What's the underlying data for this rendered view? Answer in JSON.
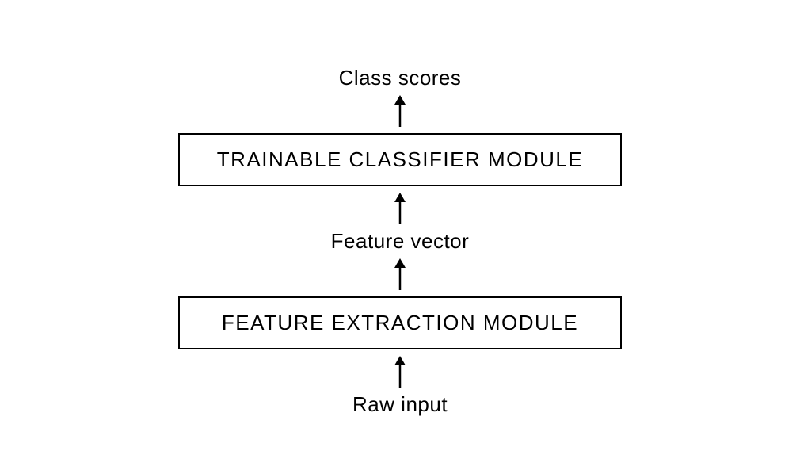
{
  "diagram": {
    "output_label": "Class scores",
    "classifier_module": "TRAINABLE CLASSIFIER MODULE",
    "intermediate_label": "Feature vector",
    "extraction_module": "FEATURE EXTRACTION MODULE",
    "input_label": "Raw input"
  }
}
